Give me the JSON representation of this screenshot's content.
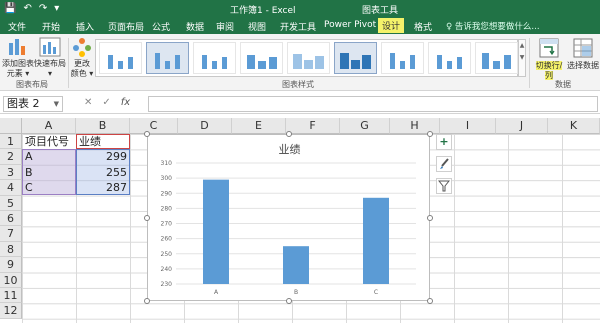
{
  "window": {
    "title": "工作簿1 - Excel",
    "context_title": "图表工具",
    "qat": [
      "save-icon",
      "undo-icon",
      "redo-icon",
      "customize-icon"
    ]
  },
  "tabs": [
    "文件",
    "开始",
    "插入",
    "页面布局",
    "公式",
    "数据",
    "审阅",
    "视图",
    "开发工具",
    "Power Pivot",
    "设计",
    "格式"
  ],
  "active_tab": "设计",
  "tell_me": "♀ 告诉我您想要做什么...",
  "ribbon": {
    "add_element": "添加图表\n元素 ▾",
    "quick_layout": "快速布局\n▾",
    "change_colors": "更改\n颜色 ▾",
    "group_layout": "图表布局",
    "group_styles": "图表样式",
    "switch_row_col": "切换行/列",
    "select_data": "选择数据",
    "group_data": "数据"
  },
  "formula_bar": {
    "name_box": "图表 2",
    "fx": "fx",
    "value": ""
  },
  "columns": [
    "A",
    "B",
    "C",
    "D",
    "E",
    "F",
    "G",
    "H",
    "I",
    "J",
    "K"
  ],
  "rows": [
    "1",
    "2",
    "3",
    "4",
    "5",
    "6",
    "7",
    "8",
    "9",
    "10",
    "11",
    "12"
  ],
  "sheet": {
    "headers": [
      "项目代号",
      "业绩"
    ],
    "data": [
      {
        "a": "A",
        "b": "299"
      },
      {
        "a": "B",
        "b": "255"
      },
      {
        "a": "C",
        "b": "287"
      }
    ]
  },
  "side_buttons": [
    "+",
    "brush-icon",
    "filter-icon"
  ],
  "chart_data": {
    "type": "bar",
    "title": "业绩",
    "categories": [
      "A",
      "B",
      "C"
    ],
    "values": [
      299,
      255,
      287
    ],
    "ylim": [
      230,
      310
    ],
    "yticks": [
      230,
      240,
      250,
      260,
      270,
      280,
      290,
      300,
      310
    ],
    "grid": true,
    "color": "#5b9bd5"
  }
}
